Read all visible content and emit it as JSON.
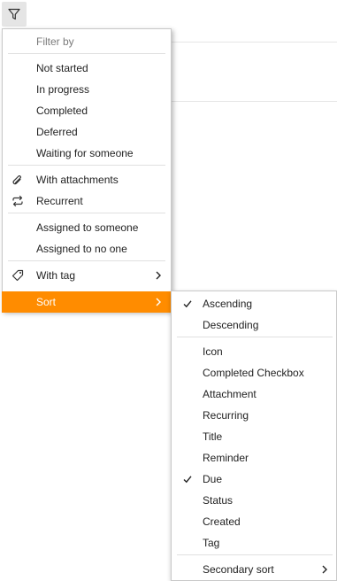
{
  "toolbar": {
    "filter_icon": "filter-funnel-icon"
  },
  "accent_color": "#ff8c00",
  "filter_menu": {
    "header": "Filter by",
    "status_items": [
      "Not started",
      "In progress",
      "Completed",
      "Deferred",
      "Waiting for someone"
    ],
    "with_attachments": {
      "label": "With attachments",
      "icon": "paperclip-icon"
    },
    "recurrent": {
      "label": "Recurrent",
      "icon": "repeat-icon"
    },
    "assigned_to_someone": "Assigned to someone",
    "assigned_to_no_one": "Assigned to no one",
    "with_tag": {
      "label": "With tag",
      "icon": "tag-icon"
    },
    "sort": {
      "label": "Sort",
      "highlighted": true
    }
  },
  "sort_menu": {
    "ascending": {
      "label": "Ascending",
      "checked": true
    },
    "descending": {
      "label": "Descending",
      "checked": false
    },
    "fields": [
      {
        "label": "Icon",
        "checked": false
      },
      {
        "label": "Completed Checkbox",
        "checked": false
      },
      {
        "label": "Attachment",
        "checked": false
      },
      {
        "label": "Recurring",
        "checked": false
      },
      {
        "label": "Title",
        "checked": false
      },
      {
        "label": "Reminder",
        "checked": false
      },
      {
        "label": "Due",
        "checked": true
      },
      {
        "label": "Status",
        "checked": false
      },
      {
        "label": "Created",
        "checked": false
      },
      {
        "label": "Tag",
        "checked": false
      }
    ],
    "secondary_sort": "Secondary sort"
  }
}
